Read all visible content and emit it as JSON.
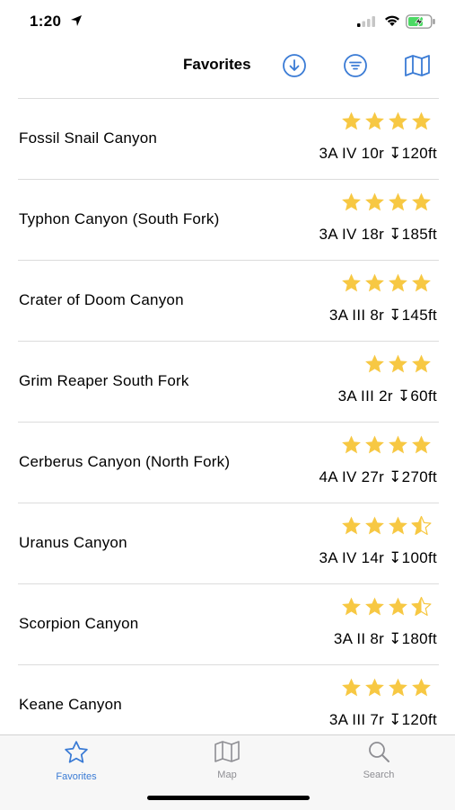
{
  "status_bar": {
    "time": "1:20",
    "icons": [
      "location-arrow-icon",
      "signal-icon",
      "wifi-icon",
      "battery-charging-icon"
    ]
  },
  "nav": {
    "title": "Favorites",
    "buttons": [
      "download-icon",
      "filter-icon",
      "map-icon"
    ],
    "accent_color": "#3a7bd5"
  },
  "canyons": [
    {
      "name": "Fossil Snail Canyon",
      "rating": 4,
      "stats": "3A IV 10r ↧120ft"
    },
    {
      "name": "Typhon Canyon (South Fork)",
      "rating": 4,
      "stats": "3A IV 18r ↧185ft"
    },
    {
      "name": "Crater of Doom Canyon",
      "rating": 4,
      "stats": "3A III 8r ↧145ft"
    },
    {
      "name": "Grim Reaper South Fork",
      "rating": 3,
      "stats": "3A III 2r ↧60ft"
    },
    {
      "name": "Cerberus Canyon (North Fork)",
      "rating": 4,
      "stats": "4A IV 27r ↧270ft"
    },
    {
      "name": "Uranus Canyon",
      "rating": 3.5,
      "stats": "3A IV 14r ↧100ft"
    },
    {
      "name": "Scorpion Canyon",
      "rating": 3.5,
      "stats": "3A II 8r ↧180ft"
    },
    {
      "name": "Keane Canyon",
      "rating": 4,
      "stats": "3A III 7r ↧120ft"
    }
  ],
  "star_color": "#f7c843",
  "tabs": [
    {
      "label": "Favorites",
      "icon": "star-icon",
      "active": true
    },
    {
      "label": "Map",
      "icon": "map-icon",
      "active": false
    },
    {
      "label": "Search",
      "icon": "search-icon",
      "active": false
    }
  ]
}
